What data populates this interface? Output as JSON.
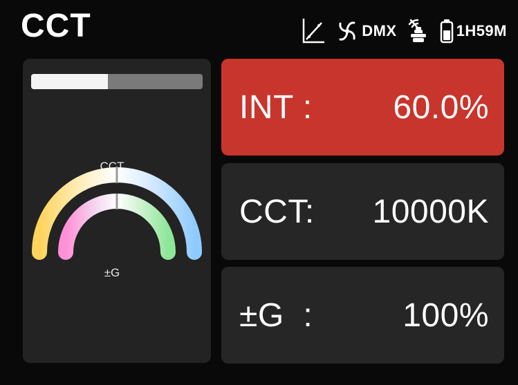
{
  "header": {
    "mode": "CCT",
    "dmx_label": "DMX",
    "battery_time": "1H59M"
  },
  "icons": {
    "curve": "curve-graph-icon",
    "fan": "fan-icon",
    "wireless": "wireless-signal-icon",
    "bag": "power-adapter-icon",
    "battery": "battery-icon"
  },
  "preview": {
    "intensity_level": 0.448,
    "cct_label": "CCT",
    "gm_label": "±G",
    "cct_gradient": [
      "#ffd35c",
      "#fff1c8",
      "#ffffff",
      "#d9ecff",
      "#8fcbff"
    ],
    "gm_gradient": [
      "#ff8fd6",
      "#f4d8f0",
      "#ffffff",
      "#d6f3d6",
      "#8ee69a"
    ]
  },
  "params": [
    {
      "name": "INT :",
      "value": "60.0%",
      "active": true
    },
    {
      "name": "CCT:",
      "value": "10000K",
      "active": false
    },
    {
      "name": "±G  :",
      "value": "100%",
      "active": false
    }
  ],
  "colors": {
    "active_card": "#c8352c",
    "card": "#262626",
    "panel": "#232323"
  }
}
